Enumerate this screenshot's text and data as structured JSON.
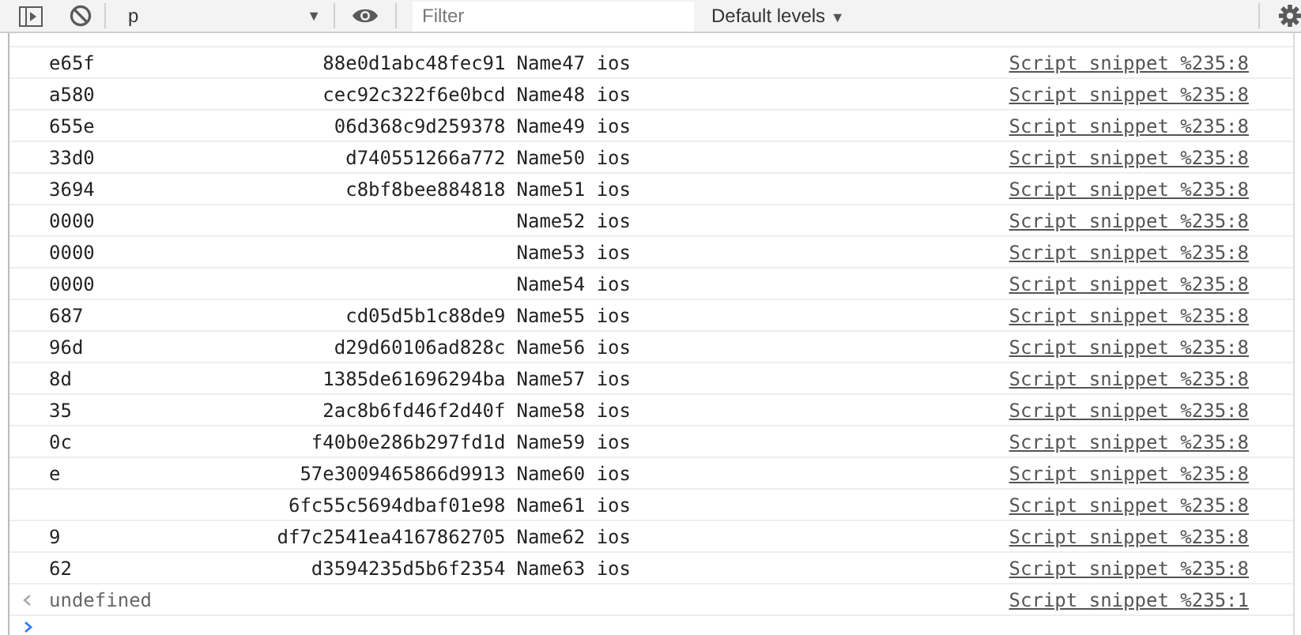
{
  "toolbar": {
    "context": "p",
    "context_caret": "▼",
    "filter_placeholder": "Filter",
    "levels": "Default levels",
    "levels_caret": "▼"
  },
  "messages": [
    {
      "prefix": "e65f",
      "tail": "88e0d1abc48fec91",
      "label": "Name47 ios",
      "source": "Script snippet %235:8"
    },
    {
      "prefix": "a580",
      "tail": "cec92c322f6e0bcd",
      "label": "Name48 ios",
      "source": "Script snippet %235:8"
    },
    {
      "prefix": "655e",
      "tail": "06d368c9d259378",
      "label": "Name49 ios",
      "source": "Script snippet %235:8"
    },
    {
      "prefix": "33d0",
      "tail": "d740551266a772",
      "label": "Name50 ios",
      "source": "Script snippet %235:8"
    },
    {
      "prefix": "3694",
      "tail": "c8bf8bee884818",
      "label": "Name51 ios",
      "source": "Script snippet %235:8"
    },
    {
      "prefix": "0000",
      "label": "Name52 ios",
      "source": "Script snippet %235:8"
    },
    {
      "prefix": "0000",
      "label": "Name53 ios",
      "source": "Script snippet %235:8"
    },
    {
      "prefix": "0000",
      "label": "Name54 ios",
      "source": "Script snippet %235:8"
    },
    {
      "prefix": "687",
      "tail": "cd05d5b1c88de9",
      "label": "Name55 ios",
      "source": "Script snippet %235:8"
    },
    {
      "prefix": "96d",
      "tail": "d29d60106ad828c",
      "label": "Name56 ios",
      "source": "Script snippet %235:8"
    },
    {
      "prefix": "8d",
      "tail": "1385de61696294ba",
      "label": "Name57 ios",
      "source": "Script snippet %235:8"
    },
    {
      "prefix": "35",
      "tail": "2ac8b6fd46f2d40f",
      "label": "Name58 ios",
      "source": "Script snippet %235:8"
    },
    {
      "prefix": "0c",
      "tail": "f40b0e286b297fd1d",
      "label": "Name59 ios",
      "source": "Script snippet %235:8"
    },
    {
      "prefix": "e",
      "tail": "57e3009465866d9913",
      "label": "Name60 ios",
      "source": "Script snippet %235:8"
    },
    {
      "tail": "6fc55c5694dbaf01e98",
      "label": "Name61 ios",
      "source": "Script snippet %235:8"
    },
    {
      "prefix": "9",
      "tail": "df7c2541ea4167862705",
      "label": "Name62 ios",
      "source": "Script snippet %235:8"
    },
    {
      "prefix": "62",
      "tail": "d3594235d5b6f2354",
      "label": "Name63 ios",
      "source": "Script snippet %235:8"
    }
  ],
  "result": {
    "value": "undefined",
    "source": "Script snippet %235:1"
  }
}
